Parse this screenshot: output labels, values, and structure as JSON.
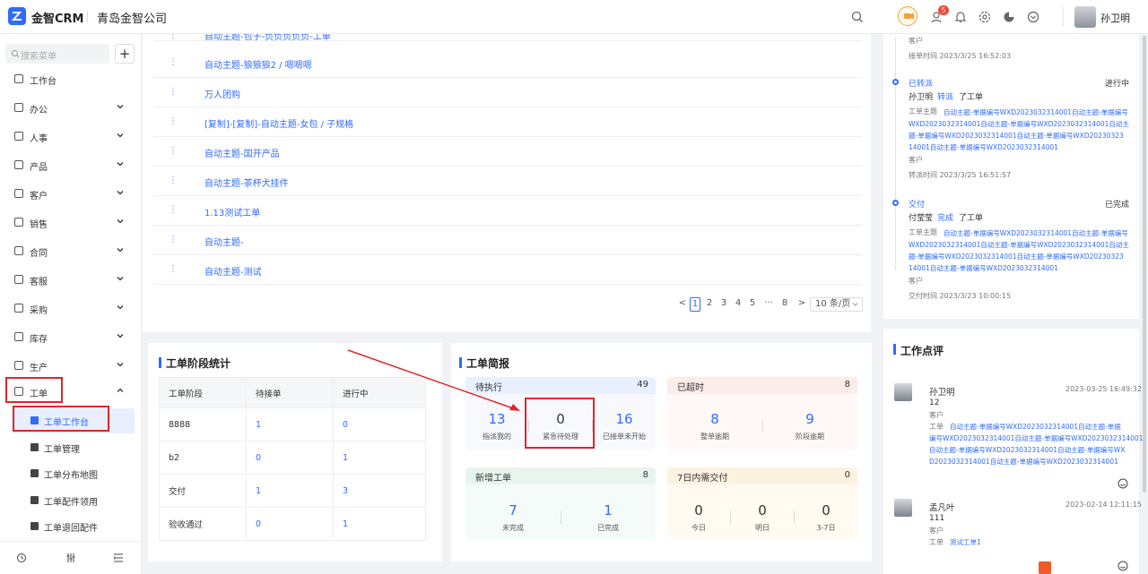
{
  "header": {
    "brand": "金智CRM",
    "company": "青岛金智公司",
    "badge_count": "5",
    "user_name": "孙卫明"
  },
  "sidebar": {
    "search_placeholder": "搜索菜单",
    "items": [
      {
        "label": "工作台",
        "expandable": false
      },
      {
        "label": "办公",
        "expandable": true
      },
      {
        "label": "人事",
        "expandable": true
      },
      {
        "label": "产品",
        "expandable": true
      },
      {
        "label": "客户",
        "expandable": true
      },
      {
        "label": "销售",
        "expandable": true
      },
      {
        "label": "合同",
        "expandable": true
      },
      {
        "label": "客服",
        "expandable": true
      },
      {
        "label": "采购",
        "expandable": true
      },
      {
        "label": "库存",
        "expandable": true
      },
      {
        "label": "生产",
        "expandable": true
      },
      {
        "label": "工单",
        "expandable": true,
        "expanded": true
      }
    ],
    "subitems": [
      {
        "label": "工单工作台",
        "active": true
      },
      {
        "label": "工单管理"
      },
      {
        "label": "工单分布地图"
      },
      {
        "label": "工单配件领用"
      },
      {
        "label": "工单退回配件"
      }
    ]
  },
  "list": {
    "top_partial": "自动主题-包子-负负负负负-工单",
    "rows": [
      "自动主题-狼狼狼2 / 嗯嗯嗯",
      "万人团购",
      "[复制]-[复制]-自动主题-女包 / 子规格",
      "自动主题-国开产品",
      "自动主题-茶杯犬挂件",
      "1.13测试工单",
      "自动主题-",
      "自动主题-测试"
    ],
    "pagination": {
      "prev": "<",
      "pages": [
        "1",
        "2",
        "3",
        "4",
        "5",
        "···",
        "8"
      ],
      "current": "1",
      "next": ">",
      "page_size": "10 条/页"
    }
  },
  "stage_stats": {
    "title": "工单阶段统计",
    "columns": [
      "工单阶段",
      "待接单",
      "进行中"
    ],
    "rows": [
      [
        "8888",
        "1",
        "0"
      ],
      [
        "b2",
        "0",
        "1"
      ],
      [
        "交付",
        "1",
        "3"
      ],
      [
        "验收通过",
        "0",
        "1"
      ]
    ]
  },
  "brief": {
    "title": "工单简报",
    "pending": {
      "title": "待执行",
      "total": "49",
      "items": [
        {
          "value": "13",
          "label": "指派我的"
        },
        {
          "value": "0",
          "label": "紧急待处理"
        },
        {
          "value": "16",
          "label": "已接单未开始"
        }
      ]
    },
    "overdue": {
      "title": "已超时",
      "total": "8",
      "items": [
        {
          "value": "8",
          "label": "整单逾期"
        },
        {
          "value": "9",
          "label": "阶段逾期"
        }
      ]
    },
    "new_orders": {
      "title": "新增工单",
      "total": "8",
      "items": [
        {
          "value": "7",
          "label": "未完成"
        },
        {
          "value": "1",
          "label": "已完成"
        }
      ]
    },
    "due7": {
      "title": "7日内需交付",
      "total": "0",
      "items": [
        {
          "value": "0",
          "label": "今日"
        },
        {
          "value": "0",
          "label": "明日"
        },
        {
          "value": "0",
          "label": "3-7日"
        }
      ]
    }
  },
  "timeline": {
    "top": {
      "customer": "客户",
      "time": "接单时间  2023/3/25 16:52:03"
    },
    "events": [
      {
        "status": "已转派",
        "state": "进行中",
        "actor": "孙卫明",
        "action": "转派",
        "target": "了工单",
        "theme_label": "工单主题",
        "theme_lines": [
          "自动主题-单据编号WXD2023032314001自动主题-单据编号",
          "WXD2023032314001自动主题-单据编号WXD2023032314001自动主",
          "题-单据编号WXD2023032314001自动主题-单据编号WXD20230323",
          "14001自动主题-单据编号WXD2023032314001"
        ],
        "customer": "客户",
        "time": "转派时间  2023/3/25 16:51:57"
      },
      {
        "status": "交付",
        "state": "已完成",
        "actor": "付莹莹",
        "action": "完成",
        "target": "了工单",
        "theme_label": "工单主题",
        "theme_lines": [
          "自动主题-单据编号WXD2023032314001自动主题-单据编号",
          "WXD2023032314001自动主题-单据编号WXD2023032314001自动主",
          "题-单据编号WXD2023032314001自动主题-单据编号WXD20230323",
          "14001自动主题-单据编号WXD2023032314001"
        ],
        "customer": "客户",
        "time": "交付时间  2023/3/23 10:00:15"
      }
    ]
  },
  "comments": {
    "title": "工作点评",
    "items": [
      {
        "name": "孙卫明",
        "time": "2023-03-25 16:49:32",
        "text": "12",
        "customer": "客户",
        "order_label": "工单",
        "order_lines": [
          "自动主题-单据编号WXD2023032314001自动主题-单据",
          "编号WXD2023032314001自动主题-单据编号WXD2023032314001",
          "自动主题-单据编号WXD2023032314001自动主题-单据编号WX",
          "D2023032314001自动主题-单据编号WXD2023032314001"
        ]
      },
      {
        "name": "孟凡叶",
        "time": "2023-02-14 12:11:15",
        "text": "111",
        "customer": "客户",
        "order_label": "工单",
        "order_lines": [
          "测试工单1"
        ]
      }
    ]
  },
  "colors": {
    "accent": "#2f6bff",
    "highlight": "#e0262b"
  }
}
